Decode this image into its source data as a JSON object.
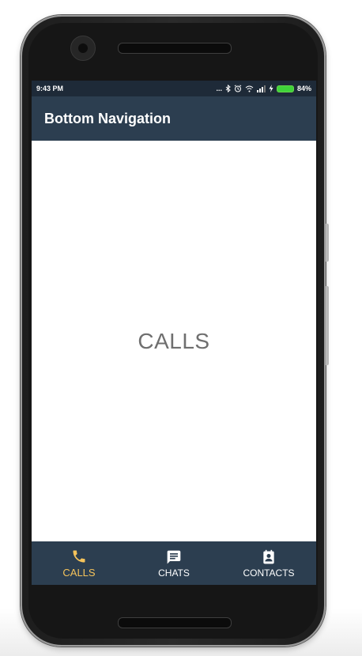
{
  "status_bar": {
    "time": "9:43 PM",
    "dots": "...",
    "battery_percent": "84%",
    "battery_color": "#3fd33a"
  },
  "app_bar": {
    "title": "Bottom Navigation",
    "background": "#2c3e50"
  },
  "content": {
    "label": "CALLS"
  },
  "bottom_nav": {
    "active_color": "#f5c35b",
    "items": [
      {
        "label": "CALLS",
        "icon": "phone-icon",
        "active": true
      },
      {
        "label": "CHATS",
        "icon": "chat-icon",
        "active": false
      },
      {
        "label": "CONTACTS",
        "icon": "contact-icon",
        "active": false
      }
    ]
  }
}
